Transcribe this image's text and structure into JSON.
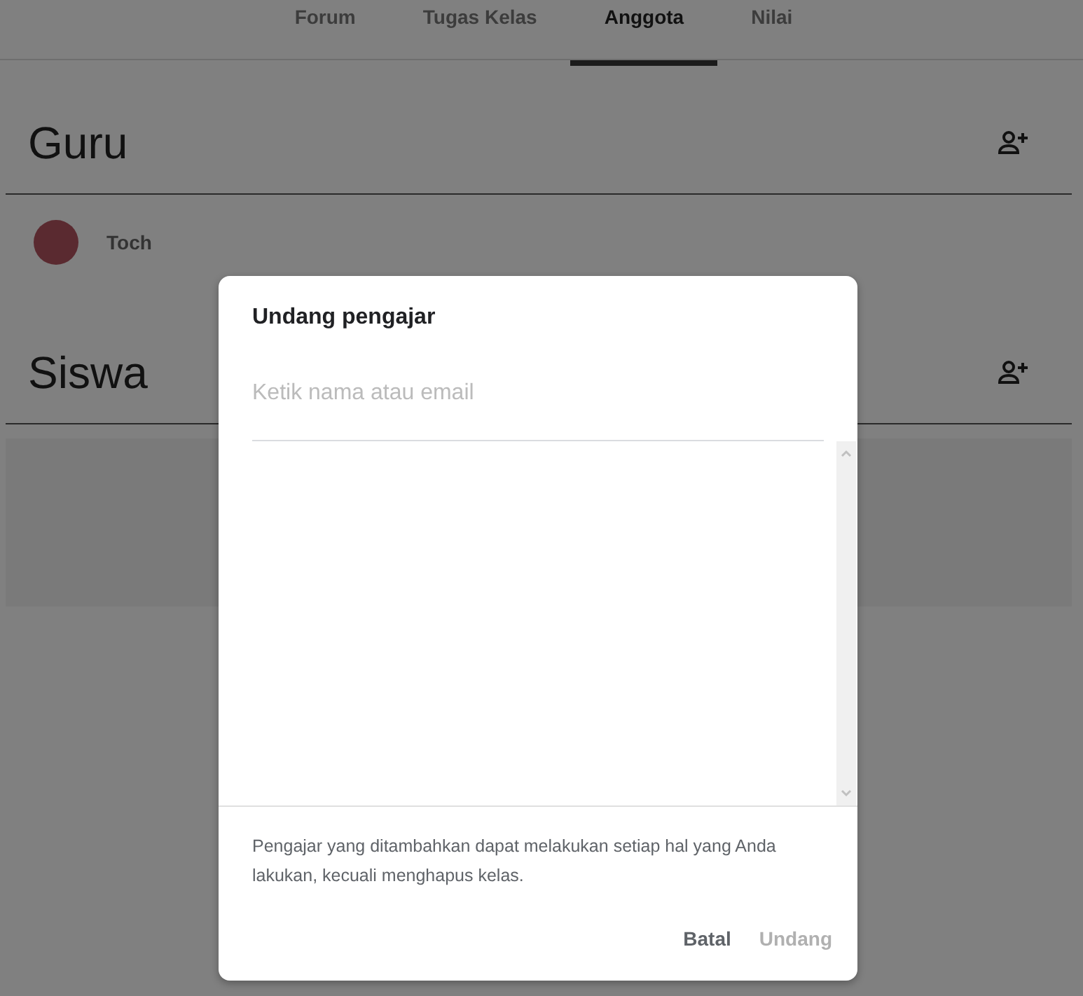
{
  "tabs": [
    {
      "label": "Forum",
      "selected": false
    },
    {
      "label": "Tugas Kelas",
      "selected": false
    },
    {
      "label": "Anggota",
      "selected": true
    },
    {
      "label": "Nilai",
      "selected": false
    }
  ],
  "sections": [
    {
      "title": "Guru",
      "members": [
        {
          "name": "Toch"
        }
      ]
    },
    {
      "title": "Siswa"
    }
  ],
  "dialog": {
    "title": "Undang pengajar",
    "field": {
      "placeholder": "Ketik nama atau email"
    },
    "note": "Pengajar yang ditambahkan dapat melakukan setiap hal yang Anda lakukan, kecuali menghapus kelas.",
    "buttons": [
      {
        "label": "Batal",
        "disabled": false
      },
      {
        "label": "Undang",
        "disabled": true
      }
    ]
  }
}
